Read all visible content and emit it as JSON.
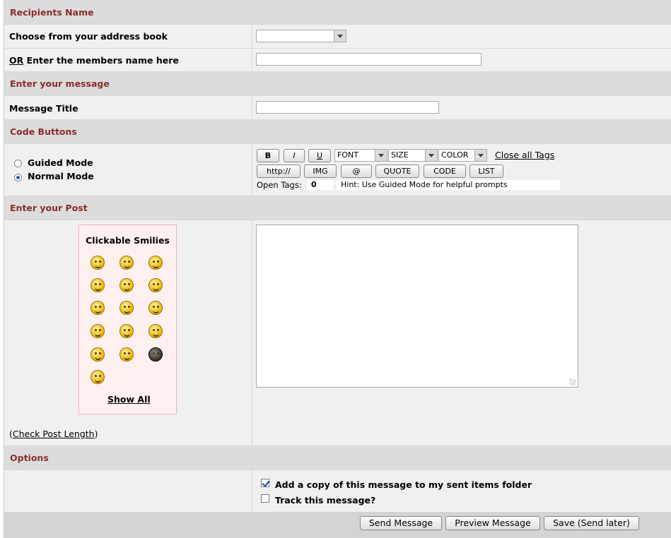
{
  "sections": {
    "recipients": "Recipients Name",
    "message": "Enter your message",
    "code_buttons": "Code Buttons",
    "post": "Enter your Post",
    "options": "Options"
  },
  "recipients": {
    "address_book_label": "Choose from your address book",
    "or_text": "OR",
    "members_label": " Enter the members name here",
    "address_book_value": "",
    "members_value": ""
  },
  "message": {
    "title_label": "Message Title",
    "title_value": ""
  },
  "code": {
    "guided_mode": "Guided Mode",
    "normal_mode": "Normal Mode",
    "selected_mode": "Normal Mode",
    "bold": "B",
    "italic": "I",
    "underline": "U",
    "font": "FONT",
    "size": "SIZE",
    "color": "COLOR",
    "close_all_tags": "Close all Tags",
    "http": "http://",
    "img": "IMG",
    "at": "@",
    "quote": "QUOTE",
    "code": "CODE",
    "list": "LIST",
    "open_tags_label": "Open Tags:",
    "open_tags_value": "0",
    "hint": "Hint: Use Guided Mode for helpful prompts"
  },
  "post": {
    "smilies_title": "Clickable Smilies",
    "smilies": [
      "smile",
      "surprised",
      "wink",
      "tongue",
      "grin",
      "laugh",
      "cool",
      "rolleyes",
      "dry",
      "happy",
      "angry",
      "sad",
      "huh",
      "blink",
      "ninja",
      "laugh-closed"
    ],
    "show_all": "Show All",
    "check_length_prefix": "(",
    "check_length": "Check Post Length",
    "check_length_suffix": ")",
    "body_value": ""
  },
  "options": {
    "copy_sent": "Add a copy of this message to my sent items folder",
    "copy_sent_checked": true,
    "track": "Track this message?",
    "track_checked": false
  },
  "actions": {
    "send": "Send Message",
    "preview": "Preview Message",
    "save": "Save (Send later)"
  }
}
